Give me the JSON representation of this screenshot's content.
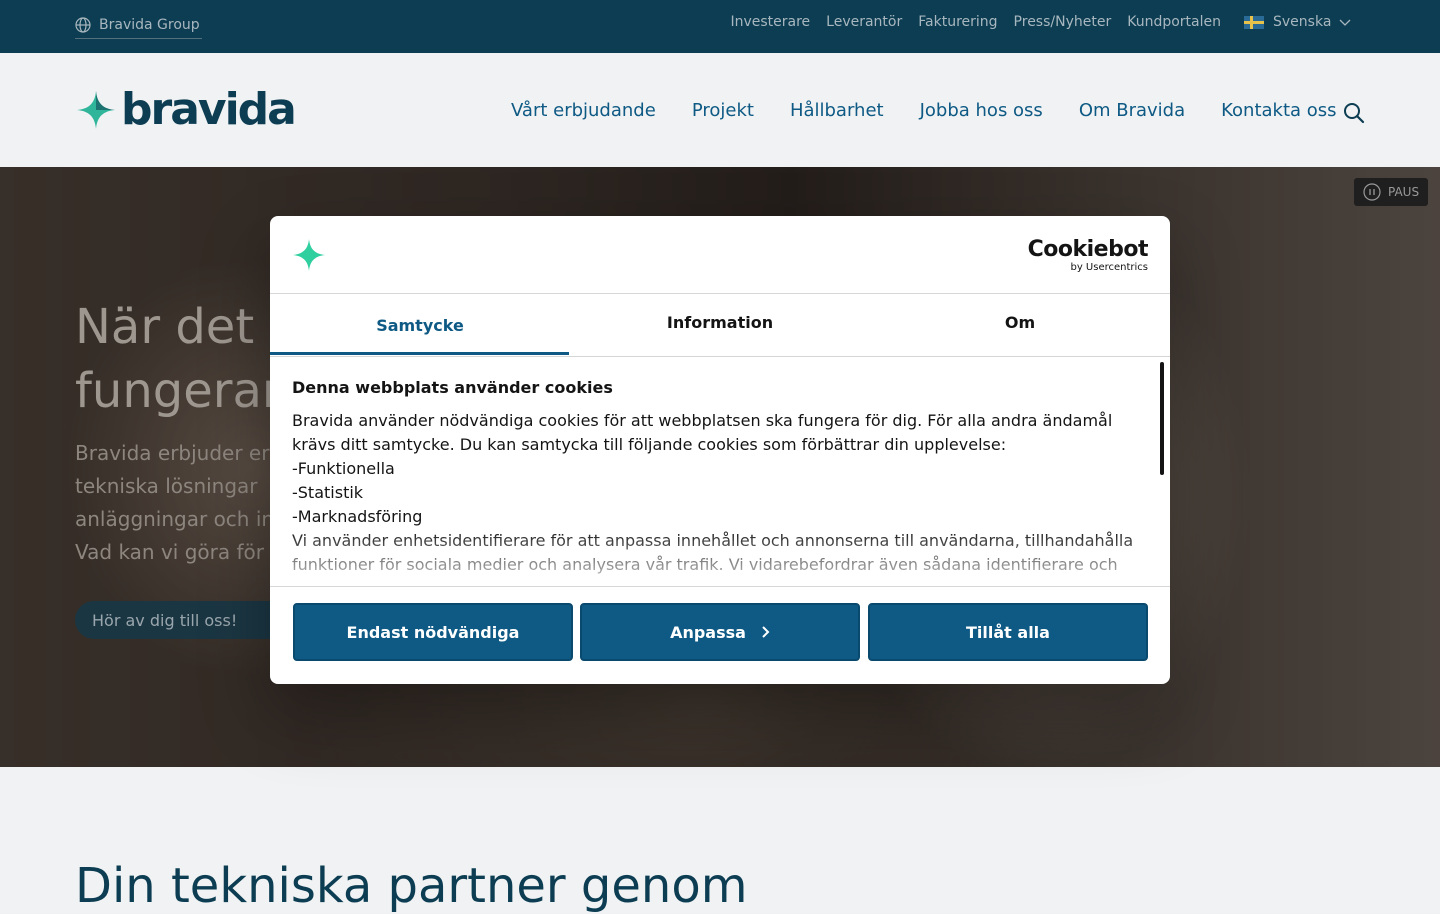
{
  "topbar": {
    "group_link": "Bravida Group",
    "links": [
      "Investerare",
      "Leverantör",
      "Fakturering",
      "Press/Nyheter",
      "Kundportalen"
    ],
    "language": "Svenska"
  },
  "header": {
    "logo_text": "bravida",
    "nav": [
      "Vårt erbjudande",
      "Projekt",
      "Hållbarhet",
      "Jobba hos oss",
      "Om Bravida",
      "Kontakta oss"
    ]
  },
  "hero": {
    "title": "När det b\nfungerar",
    "text": "Bravida erbjuder er\ntekniska lösningar\nanläggningar och in\nVad kan vi göra för",
    "cta": "Hör av dig till oss!",
    "pause_label": "PAUS"
  },
  "below": {
    "title": "Din tekniska partner genom"
  },
  "cookie_dialog": {
    "brand": "Cookiebot",
    "brand_sub": "by Usercentrics",
    "tabs": [
      "Samtycke",
      "Information",
      "Om"
    ],
    "heading": "Denna webbplats använder cookies",
    "body": "Bravida använder nödvändiga cookies för att webbplatsen ska fungera för dig. För alla andra ändamål krävs ditt samtycke. Du kan samtycka till följande cookies som förbättrar din upplevelse:\n-Funktionella\n-Statistik\n-Marknadsföring\nVi använder enhetsidentifierare för att anpassa innehållet och annonserna till användarna, tillhandahålla funktioner för sociala medier och analysera vår trafik. Vi vidarebefordrar även sådana identifierare och",
    "buttons": {
      "necessary": "Endast nödvändiga",
      "customize": "Anpassa",
      "allow_all": "Tillåt alla"
    }
  },
  "colors": {
    "navy": "#0c3d52",
    "accent_blue": "#0e5a85",
    "logo_green": "#2fb59a"
  }
}
